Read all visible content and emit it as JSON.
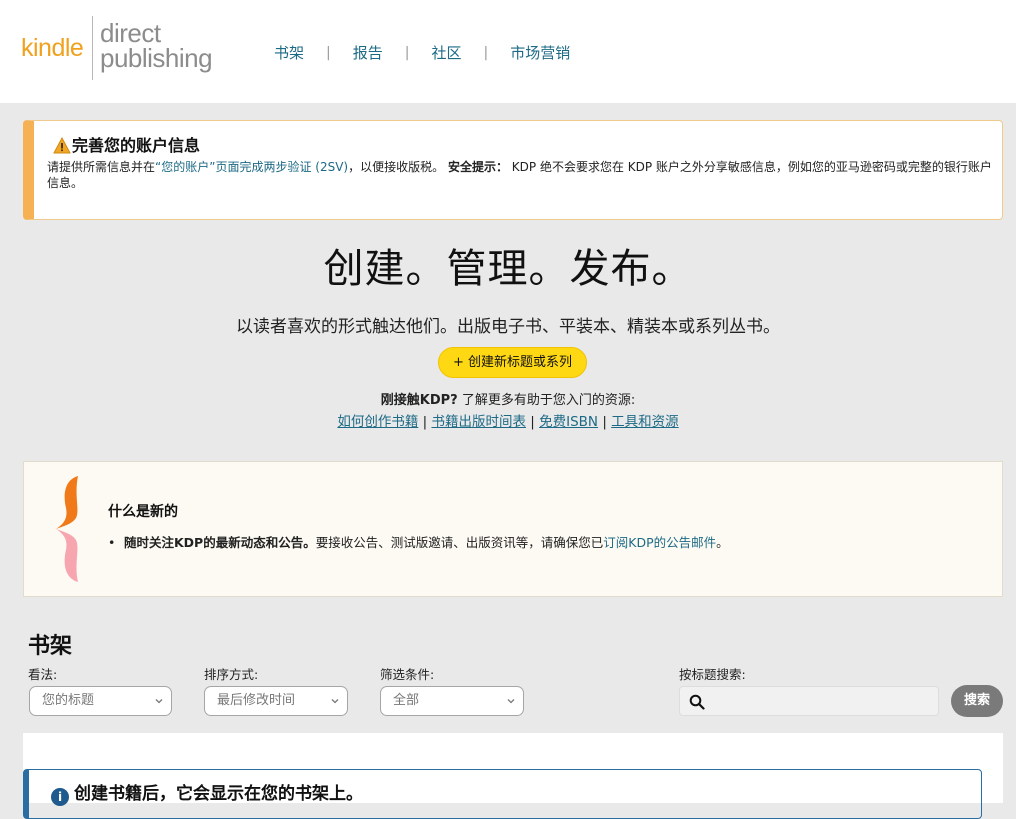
{
  "header": {
    "logo": {
      "word1": "kindle",
      "word2": "direct",
      "word3": "publishing"
    },
    "nav": [
      "书架",
      "报告",
      "社区",
      "市场营销"
    ],
    "nav_separator": "|"
  },
  "alert": {
    "title": "完善您的账户信息",
    "body_prefix": "请提供所需信息并在",
    "body_link": "“您的账户”页面完成两步验证 (2SV)",
    "body_mid": "，以便接收版税。",
    "safety_label": "安全提示：",
    "safety_text": "KDP 绝不会要求您在 KDP 账户之外分享敏感信息，例如您的亚马逊密码或完整的银行账户信息。"
  },
  "hero": {
    "title": "创建。管理。发布。",
    "subtitle": "以读者喜欢的形式触达他们。出版电子书、平装本、精装本或系列丛书。",
    "create_button": "+ 创建新标题或系列",
    "newbie_bold": "刚接触KDP?",
    "newbie_text": " 了解更多有助于您入门的资源:",
    "links": [
      "如何创作书籍",
      "书籍出版时间表",
      "免费ISBN",
      "工具和资源"
    ],
    "link_separator": " | "
  },
  "news": {
    "title": "什么是新的",
    "item_bold": "随时关注KDP的最新动态和公告。",
    "item_text": "要接收公告、测试版邀请、出版资讯等，请确保您已",
    "item_link": "订阅KDP的公告邮件",
    "item_end": "。",
    "bullet": "•"
  },
  "bookshelf": {
    "title": "书架",
    "view_label": "看法:",
    "view_value": "您的标题",
    "sort_label": "排序方式:",
    "sort_value": "最后修改时间",
    "filter_label": "筛选条件:",
    "filter_value": "全部",
    "search_label": "按标题搜索:",
    "search_placeholder": "",
    "search_button": "搜索",
    "info_message": "创建书籍后，它会显示在您的书架上。",
    "info_icon_glyph": "i"
  },
  "colors": {
    "nav_link": "#1d6a86",
    "alert_accent": "#f6b154",
    "create_button": "#ffd814",
    "search_button": "#7a7a7a",
    "info_border": "#2a6da1",
    "logo_kindle": "#f0a21f",
    "brace_top": "#f07a1a",
    "brace_bottom": "#f7a6b0"
  },
  "icons": {
    "alert": "warning-triangle-icon",
    "search": "magnifier-icon",
    "select": "chevron-down-icon",
    "news": "kdp-brace-icon",
    "info": "info-circle-icon"
  }
}
